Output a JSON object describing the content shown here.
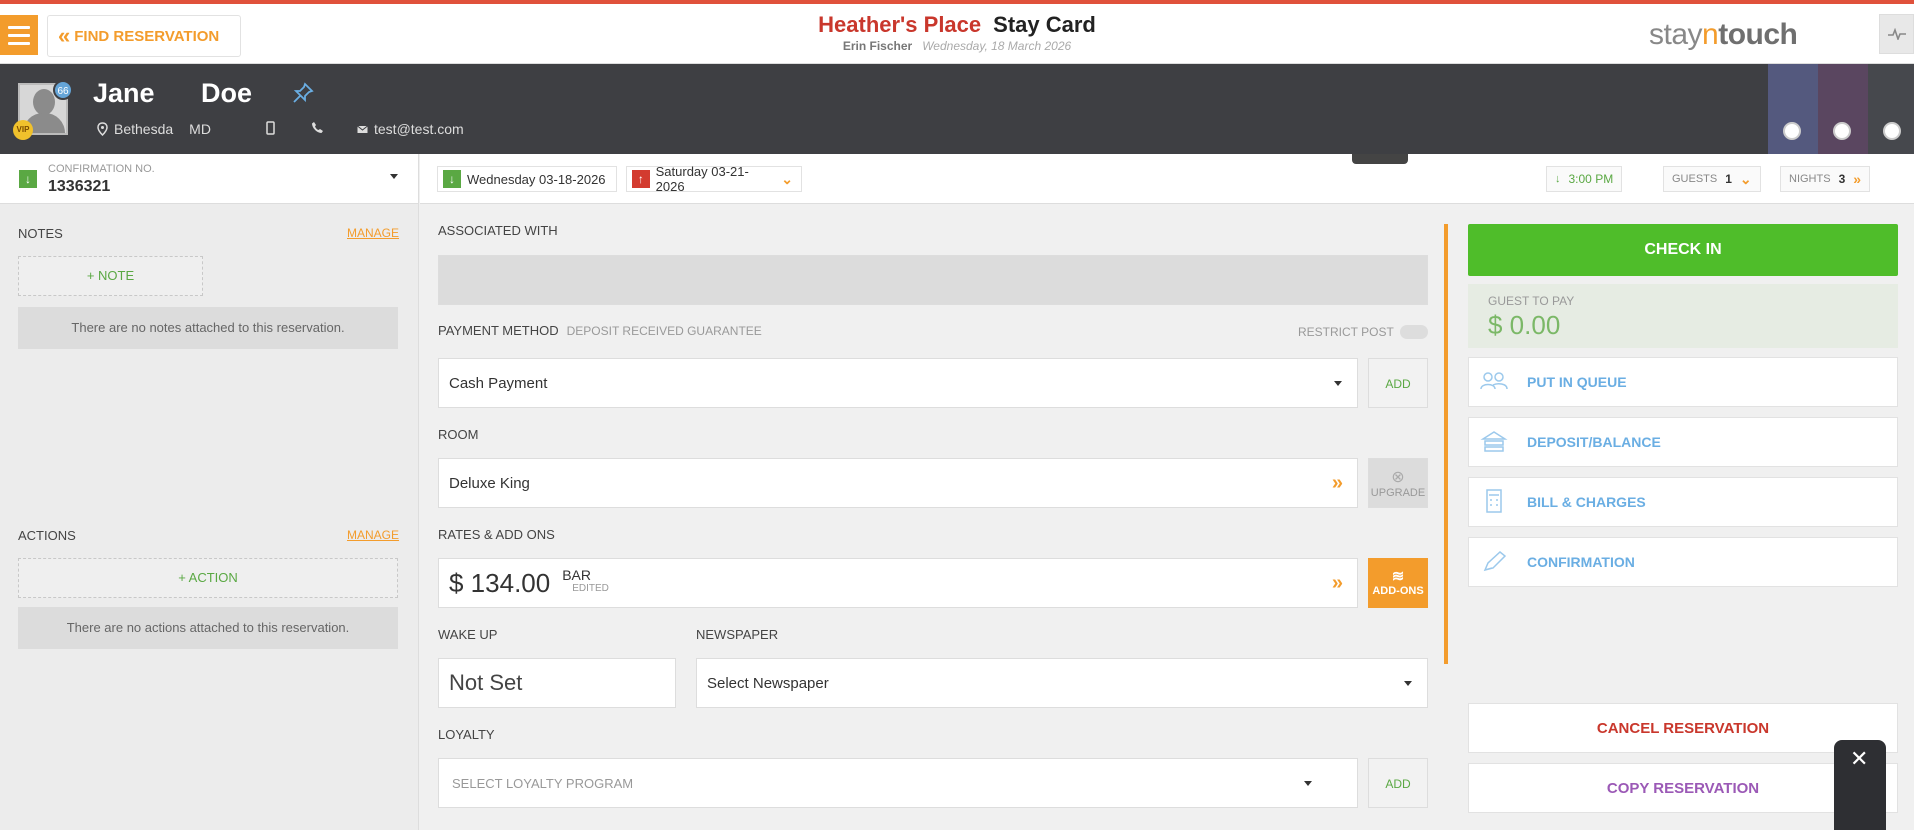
{
  "header": {
    "find_label": "FIND RESERVATION",
    "hotel_name": "Heather's Place",
    "page_title": "Stay Card",
    "user_name": "Erin Fischer",
    "business_date": "Wednesday, 18 March 2026",
    "brand_pre": "stay",
    "brand_n": "n",
    "brand_touch": "touch"
  },
  "guest": {
    "first_name": "Jane",
    "last_name": "Doe",
    "badge_count": "66",
    "vip_label": "VIP",
    "city": "Bethesda",
    "state": "MD",
    "email": "test@test.com"
  },
  "colors": {
    "accent": "#f39c2c",
    "primary_green": "#4fbd2a",
    "header_dark": "#3e3f43",
    "hotel_red": "#c9372c",
    "link_blue": "#6aaee3"
  },
  "confirmation": {
    "label": "CONFIRMATION NO.",
    "number": "1336321"
  },
  "notes": {
    "heading": "NOTES",
    "manage": "MANAGE",
    "add_label": "+ NOTE",
    "empty_text": "There are no notes attached to this reservation."
  },
  "actions": {
    "heading": "ACTIONS",
    "manage": "MANAGE",
    "add_label": "+ ACTION",
    "empty_text": "There are no actions attached to this reservation."
  },
  "stay": {
    "arrival": "Wednesday 03-18-2026",
    "departure": "Saturday 03-21-2026",
    "arrival_time": "3:00 PM",
    "guests_label": "GUESTS",
    "guests_value": "1",
    "nights_label": "NIGHTS",
    "nights_value": "3"
  },
  "form": {
    "associated_label": "ASSOCIATED WITH",
    "payment_label": "PAYMENT METHOD",
    "payment_sub": "DEPOSIT RECEIVED GUARANTEE",
    "restrict_post_label": "RESTRICT POST",
    "payment_value": "Cash Payment",
    "add_label": "ADD",
    "room_label": "ROOM",
    "room_value": "Deluxe King",
    "upgrade_label": "UPGRADE",
    "rates_label": "RATES & ADD ONS",
    "rate_amount": "$ 134.00",
    "rate_code": "BAR",
    "rate_status": "EDITED",
    "addons_label": "ADD-ONS",
    "wakeup_label": "WAKE UP",
    "wakeup_value": "Not Set",
    "newspaper_label": "NEWSPAPER",
    "newspaper_value": "Select Newspaper",
    "loyalty_label": "LOYALTY",
    "loyalty_placeholder": "SELECT LOYALTY PROGRAM"
  },
  "right_panel": {
    "checkin_label": "CHECK IN",
    "guest_to_pay_label": "GUEST TO PAY",
    "guest_to_pay_amount": "$ 0.00",
    "put_in_queue": "PUT IN QUEUE",
    "deposit_balance": "DEPOSIT/BALANCE",
    "bill_charges": "BILL & CHARGES",
    "confirmation": "CONFIRMATION",
    "cancel_reservation": "CANCEL RESERVATION",
    "copy_reservation": "COPY RESERVATION"
  },
  "icons": [
    "menu-icon",
    "double-chevron-left-icon",
    "pulse-icon",
    "pin-icon",
    "location-icon",
    "mobile-icon",
    "phone-icon",
    "email-icon",
    "arrival-arrow-icon",
    "departure-arrow-icon",
    "double-chevron-right-icon",
    "queue-icon",
    "deposit-icon",
    "calculator-icon",
    "pen-icon",
    "close-icon"
  ]
}
